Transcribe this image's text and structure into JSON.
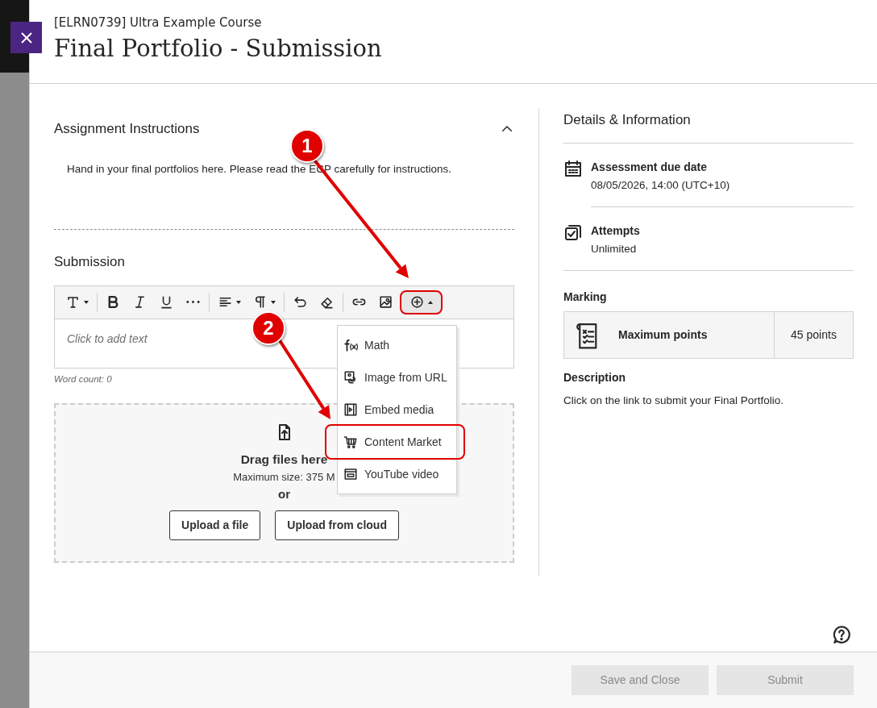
{
  "panel": {
    "course": "[ELRN0739] Ultra Example Course",
    "title": "Final Portfolio - Submission"
  },
  "instructions": {
    "heading": "Assignment Instructions",
    "expanded": true,
    "text": "Hand in your final portfolios here. Please read the ECP carefully for instructions."
  },
  "submission": {
    "heading": "Submission",
    "toolbar": [
      {
        "kind": "text-style",
        "dropdown": true,
        "highlighted": false
      },
      {
        "kind": "bold",
        "dropdown": false,
        "highlighted": false
      },
      {
        "kind": "italic",
        "dropdown": false,
        "highlighted": false
      },
      {
        "kind": "underline",
        "dropdown": false,
        "highlighted": false
      },
      {
        "kind": "more",
        "dropdown": false,
        "highlighted": false
      },
      {
        "kind": "align",
        "dropdown": true,
        "highlighted": false
      },
      {
        "kind": "paragraph",
        "dropdown": true,
        "highlighted": false
      },
      {
        "kind": "undo",
        "dropdown": false,
        "highlighted": false
      },
      {
        "kind": "eraser",
        "dropdown": false,
        "highlighted": false
      },
      {
        "kind": "link",
        "dropdown": false,
        "highlighted": false
      },
      {
        "kind": "image",
        "dropdown": false,
        "highlighted": false
      },
      {
        "kind": "insert",
        "dropdown": true,
        "highlighted": true
      }
    ],
    "placeholder": "Click to add text",
    "word_count": "Word count: 0",
    "insert_menu": [
      {
        "kind": "math",
        "label": "Math",
        "highlighted": false
      },
      {
        "kind": "image-url",
        "label": "Image from URL",
        "highlighted": false
      },
      {
        "kind": "embed",
        "label": "Embed media",
        "highlighted": false
      },
      {
        "kind": "market",
        "label": "Content Market",
        "highlighted": true
      },
      {
        "kind": "youtube",
        "label": "YouTube video",
        "highlighted": false
      }
    ],
    "dropzone": {
      "heading": "Drag files here",
      "max_size": "Maximum size: 375 M",
      "or": "or",
      "buttons": [
        "Upload a file",
        "Upload from cloud"
      ]
    }
  },
  "details": {
    "heading": "Details & Information",
    "items": [
      {
        "kind": "due",
        "label": "Assessment due date",
        "value": "08/05/2026, 14:00 (UTC+10)"
      },
      {
        "kind": "attempts",
        "label": "Attempts",
        "value": "Unlimited"
      }
    ],
    "marking": {
      "heading": "Marking",
      "label": "Maximum points",
      "value": "45 points"
    },
    "description": {
      "heading": "Description",
      "text": "Click on the link to submit your Final Portfolio."
    }
  },
  "footer": {
    "buttons": [
      {
        "label": "Save and Close",
        "disabled": true
      },
      {
        "label": "Submit",
        "disabled": true
      }
    ]
  },
  "annotations": [
    {
      "label": "1"
    },
    {
      "label": "2"
    }
  ]
}
